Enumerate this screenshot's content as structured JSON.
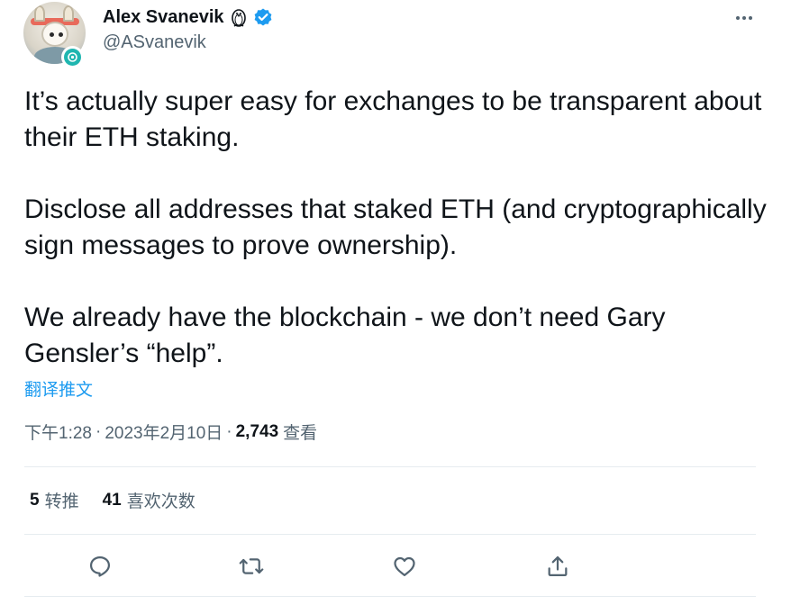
{
  "author": {
    "display_name": "Alex Svanevik",
    "handle": "@ASvanevik"
  },
  "tweet": {
    "paragraph_1": "It’s actually super easy for exchanges to be transparent about their ETH staking.",
    "paragraph_2": "Disclose all addresses that staked ETH (and cryptographically sign messages to prove ownership).",
    "paragraph_3": "We already have the blockchain - we don’t need Gary Gensler’s “help”."
  },
  "translate_label": "翻译推文",
  "meta": {
    "time": "下午1:28",
    "date": "2023年2月10日",
    "separator": "·",
    "views_count": "2,743",
    "views_label": "查看"
  },
  "stats": {
    "retweets_count": "5",
    "retweets_label": "转推",
    "likes_count": "41",
    "likes_label": "喜欢次数"
  },
  "icons": {
    "name_emoji": "penguin-icon",
    "verified": "verified-badge-icon",
    "more": "more-icon",
    "reply": "reply-icon",
    "retweet": "retweet-icon",
    "like": "heart-icon",
    "share": "share-icon"
  },
  "colors": {
    "text_primary": "#0f1419",
    "text_secondary": "#536471",
    "link": "#1d9bf0",
    "verified": "#1d9bf0",
    "divider": "#e6ecf0"
  }
}
